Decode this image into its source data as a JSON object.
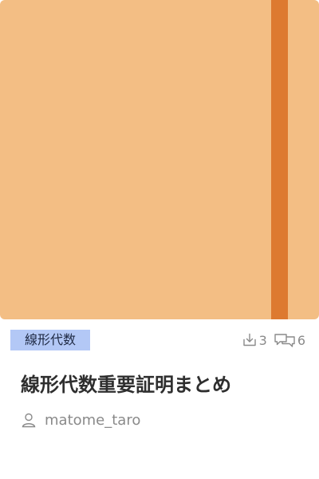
{
  "colors": {
    "cover": "#f3be84",
    "band": "#dd7a30",
    "tag_bg": "#b3c8f6"
  },
  "card": {
    "tag": "線形代数",
    "downloads": "3",
    "comments": "6",
    "title": "線形代数重要証明まとめ",
    "author": "matome_taro"
  },
  "icons": {
    "downloads": "download-icon",
    "comments": "comments-icon",
    "author": "user-icon"
  }
}
